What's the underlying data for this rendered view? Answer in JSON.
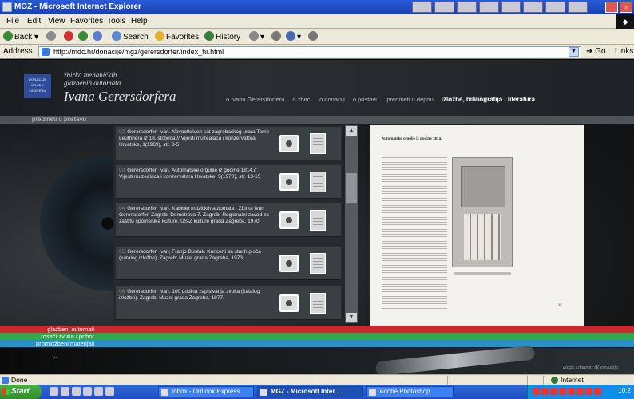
{
  "window": {
    "title": "MGZ - Microsoft Internet Explorer"
  },
  "menu": [
    "File",
    "Edit",
    "View",
    "Favorites",
    "Tools",
    "Help"
  ],
  "toolbar": {
    "back": "Back",
    "search": "Search",
    "favorites": "Favorites",
    "history": "History"
  },
  "address": {
    "label": "Address",
    "url": "http://mdc.hr/donacije/mgz/gerersdorfer/index_hr.html",
    "go": "Go",
    "links": "Links"
  },
  "site": {
    "logo_text": "DONACIJE GRADU ZAGREBU",
    "subtitle_line1": "zbirka mehaničkih",
    "subtitle_line2": "glazbenih automata",
    "title": "Ivana Gerersdorfera",
    "nav": [
      {
        "label": "o Ivanu Gerersdorferu",
        "active": false
      },
      {
        "label": "o zbirci",
        "active": false
      },
      {
        "label": "o donaciji",
        "active": false
      },
      {
        "label": "o postavu",
        "active": false
      },
      {
        "label": "predmeti u depou",
        "active": false
      },
      {
        "label": "izložbe, bibliografija i literatura",
        "active": true
      }
    ],
    "breadcrumb": "predmeti u postavu",
    "categories": [
      {
        "label": "glazbeni automati",
        "color": "#c8282e"
      },
      {
        "label": "rosači zvuka i pribor",
        "color": "#2fa84e"
      },
      {
        "label": "promidžbeni materijali",
        "color": "#2a8fc8"
      }
    ],
    "credit": "dizajn i natemir (R)evolucija"
  },
  "bibliography": [
    {
      "num": "02",
      "text": "Gerersdorfer, Ivan. Novootkriven sat zagrebačkog urara Tome Leuthnera iz 18. stoljeća.// Vijesti muzealaca i konzervatora Hrvatske, 1(1969), str. 3-5"
    },
    {
      "num": "03",
      "text": "Gerersdorfer, Ivan. Automatske orguljie iz godine 1814.// Vijesti muzealaca i konzervatora Hrvatske, 5(1970), str. 13-15"
    },
    {
      "num": "04",
      "text": "Gerersdorfer, Ivan. Kabinet muzičkih automata : Zbirka Ivan Gerersdorfer, Zagreb, Demetrova 7. Zagreb: Regionalni zavod za zaštitu spomenika kulture, USIZ kulture grada Zagreba, 1970."
    },
    {
      "num": "05",
      "text": "Gerersdorfer, Ivan; Franjo Buntak. Koncerti sa starih ploča (katalog izložbe). Zagreb: Muzej grada Zagreba, 1973."
    },
    {
      "num": "06",
      "text": "Gerersdorfer, Ivan. 100 godina zapisivanja zvuka (katalog izložbe). Zagreb: Muzej grada Zagreba, 1977."
    }
  ],
  "preview": {
    "title": "Automatske orgulje iz godine 1814.",
    "page_number": "15"
  },
  "statusbar": {
    "status": "Done",
    "zone": "Internet"
  },
  "taskbar": {
    "start": "Start",
    "tasks": [
      {
        "label": "Inbox - Outlook Express",
        "active": false
      },
      {
        "label": "MGZ - Microsoft Inter...",
        "active": true
      },
      {
        "label": "Adobe Photoshop",
        "active": false
      }
    ],
    "clock": "10:2"
  }
}
